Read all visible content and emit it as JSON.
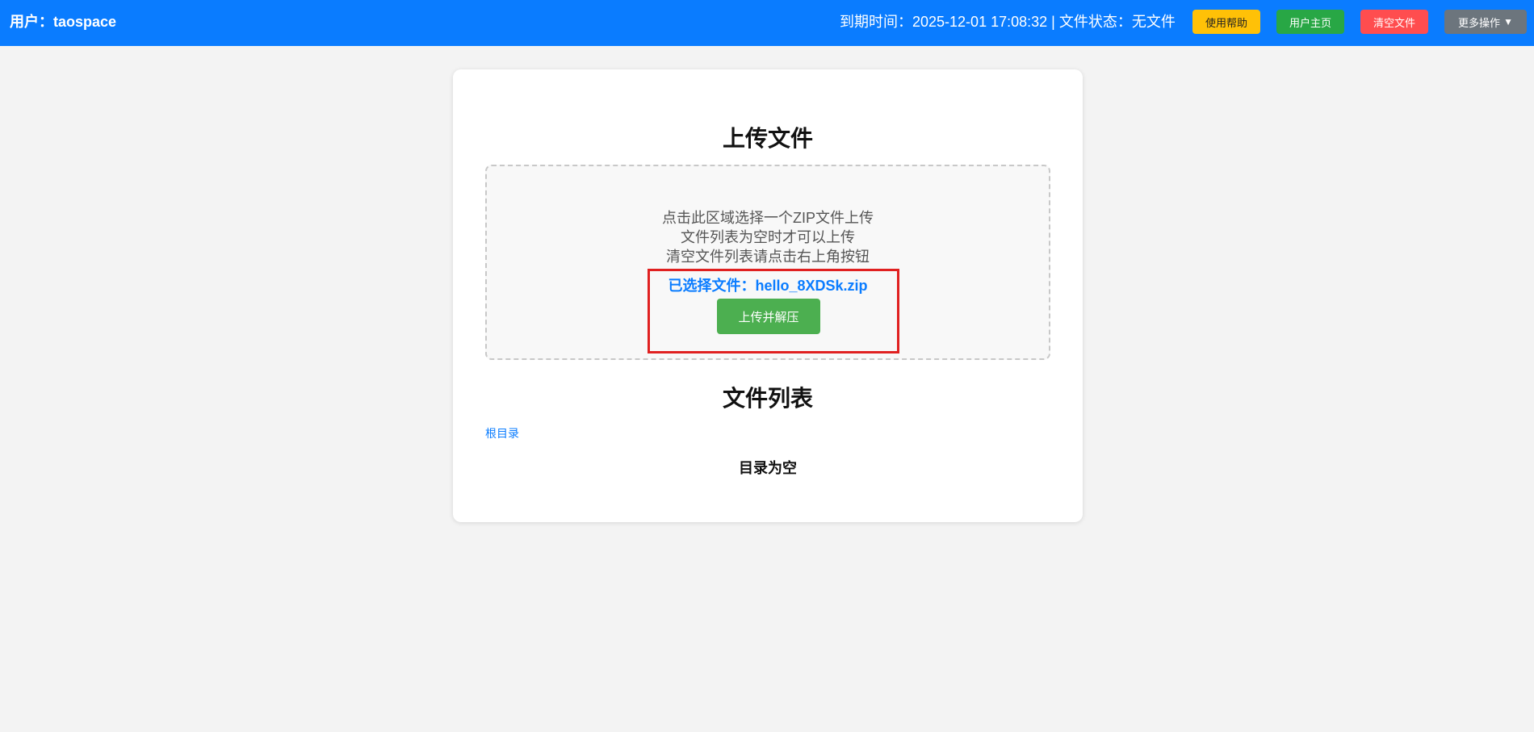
{
  "header": {
    "user_label": "用户：taospace",
    "status_text": "到期时间：2025-12-01 17:08:32 | 文件状态：无文件",
    "buttons": {
      "help": "使用帮助",
      "home": "用户主页",
      "clear": "清空文件",
      "more": "更多操作",
      "more_caret": "▼"
    },
    "colors": {
      "bar": "#0a7cff",
      "help": "#ffc107",
      "home": "#28a745",
      "clear": "#ff4d4f",
      "more": "#6c757d"
    }
  },
  "upload": {
    "title": "上传文件",
    "hints": [
      "点击此区域选择一个ZIP文件上传",
      "文件列表为空时才可以上传",
      "清空文件列表请点击右上角按钮"
    ],
    "selected_file": "已选择文件：hello_8XDSk.zip",
    "upload_button": "上传并解压"
  },
  "file_list": {
    "title": "文件列表",
    "breadcrumb": "根目录",
    "empty_message": "目录为空"
  }
}
